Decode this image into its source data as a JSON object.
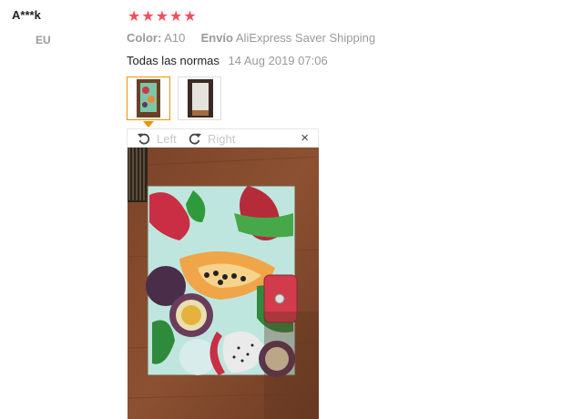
{
  "reviewer": {
    "name": "A***k",
    "country": "EU"
  },
  "rating": {
    "stars": "★★★★★",
    "value": 5
  },
  "meta": {
    "color_label": "Color:",
    "color_value": "A10",
    "shipping_label": "Envío",
    "shipping_value": "AliExpress Saver Shipping"
  },
  "feedback": {
    "text": "Todas las normas",
    "date": "14 Aug 2019 07:06"
  },
  "viewer": {
    "rotate_left_label": "Left",
    "rotate_right_label": "Right",
    "close_symbol": "×"
  },
  "icons": {
    "rotate_left": "rotate-left-icon",
    "rotate_right": "rotate-right-icon",
    "close": "close-icon"
  },
  "colors": {
    "star": "#f0505a",
    "selected_border": "#f09000",
    "muted_text": "#999999"
  }
}
